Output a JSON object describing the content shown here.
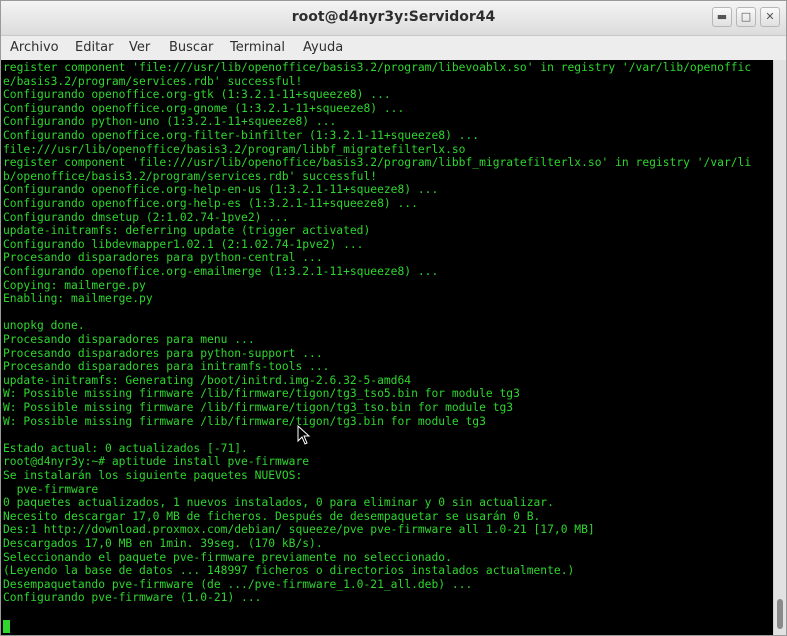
{
  "window": {
    "title": "root@d4nyr3y:Servidor44"
  },
  "window_controls": {
    "minimize_icon": "minimize-icon",
    "maximize_icon": "maximize-icon",
    "close_icon": "close-icon"
  },
  "menu": [
    "Archivo",
    "Editar",
    "Ver",
    "Buscar",
    "Terminal",
    "Ayuda"
  ],
  "terminal": {
    "lines": [
      "register component 'file:///usr/lib/openoffice/basis3.2/program/libevoablx.so' in registry '/var/lib/openoffic",
      "e/basis3.2/program/services.rdb' successful!",
      "Configurando openoffice.org-gtk (1:3.2.1-11+squeeze8) ...",
      "Configurando openoffice.org-gnome (1:3.2.1-11+squeeze8) ...",
      "Configurando python-uno (1:3.2.1-11+squeeze8) ...",
      "Configurando openoffice.org-filter-binfilter (1:3.2.1-11+squeeze8) ...",
      "file:///usr/lib/openoffice/basis3.2/program/libbf_migratefilterlx.so",
      "register component 'file:///usr/lib/openoffice/basis3.2/program/libbf_migratefilterlx.so' in registry '/var/li",
      "b/openoffice/basis3.2/program/services.rdb' successful!",
      "Configurando openoffice.org-help-en-us (1:3.2.1-11+squeeze8) ...",
      "Configurando openoffice.org-help-es (1:3.2.1-11+squeeze8) ...",
      "Configurando dmsetup (2:1.02.74-1pve2) ...",
      "update-initramfs: deferring update (trigger activated)",
      "Configurando libdevmapper1.02.1 (2:1.02.74-1pve2) ...",
      "Procesando disparadores para python-central ...",
      "Configurando openoffice.org-emailmerge (1:3.2.1-11+squeeze8) ...",
      "Copying: mailmerge.py",
      "Enabling: mailmerge.py",
      "",
      "unopkg done.",
      "Procesando disparadores para menu ...",
      "Procesando disparadores para python-support ...",
      "Procesando disparadores para initramfs-tools ...",
      "update-initramfs: Generating /boot/initrd.img-2.6.32-5-amd64",
      "W: Possible missing firmware /lib/firmware/tigon/tg3_tso5.bin for module tg3",
      "W: Possible missing firmware /lib/firmware/tigon/tg3_tso.bin for module tg3",
      "W: Possible missing firmware /lib/firmware/tigon/tg3.bin for module tg3",
      "",
      "Estado actual: 0 actualizados [-71].",
      "root@d4nyr3y:~# aptitude install pve-firmware",
      "Se instalarán los siguiente paquetes NUEVOS:",
      "  pve-firmware",
      "0 paquetes actualizados, 1 nuevos instalados, 0 para eliminar y 0 sin actualizar.",
      "Necesito descargar 17,0 MB de ficheros. Después de desempaquetar se usarán 0 B.",
      "Des:1 http://download.proxmox.com/debian/ squeeze/pve pve-firmware all 1.0-21 [17,0 MB]",
      "Descargados 17,0 MB en 1min. 39seg. (170 kB/s).",
      "Seleccionando el paquete pve-firmware previamente no seleccionado.",
      "(Leyendo la base de datos ... 148997 ficheros o directorios instalados actualmente.)",
      "Desempaquetando pve-firmware (de .../pve-firmware_1.0-21_all.deb) ...",
      "Configurando pve-firmware (1.0-21) ..."
    ]
  },
  "colors": {
    "terminal_bg": "#000000",
    "terminal_fg": "#2ed62e"
  }
}
